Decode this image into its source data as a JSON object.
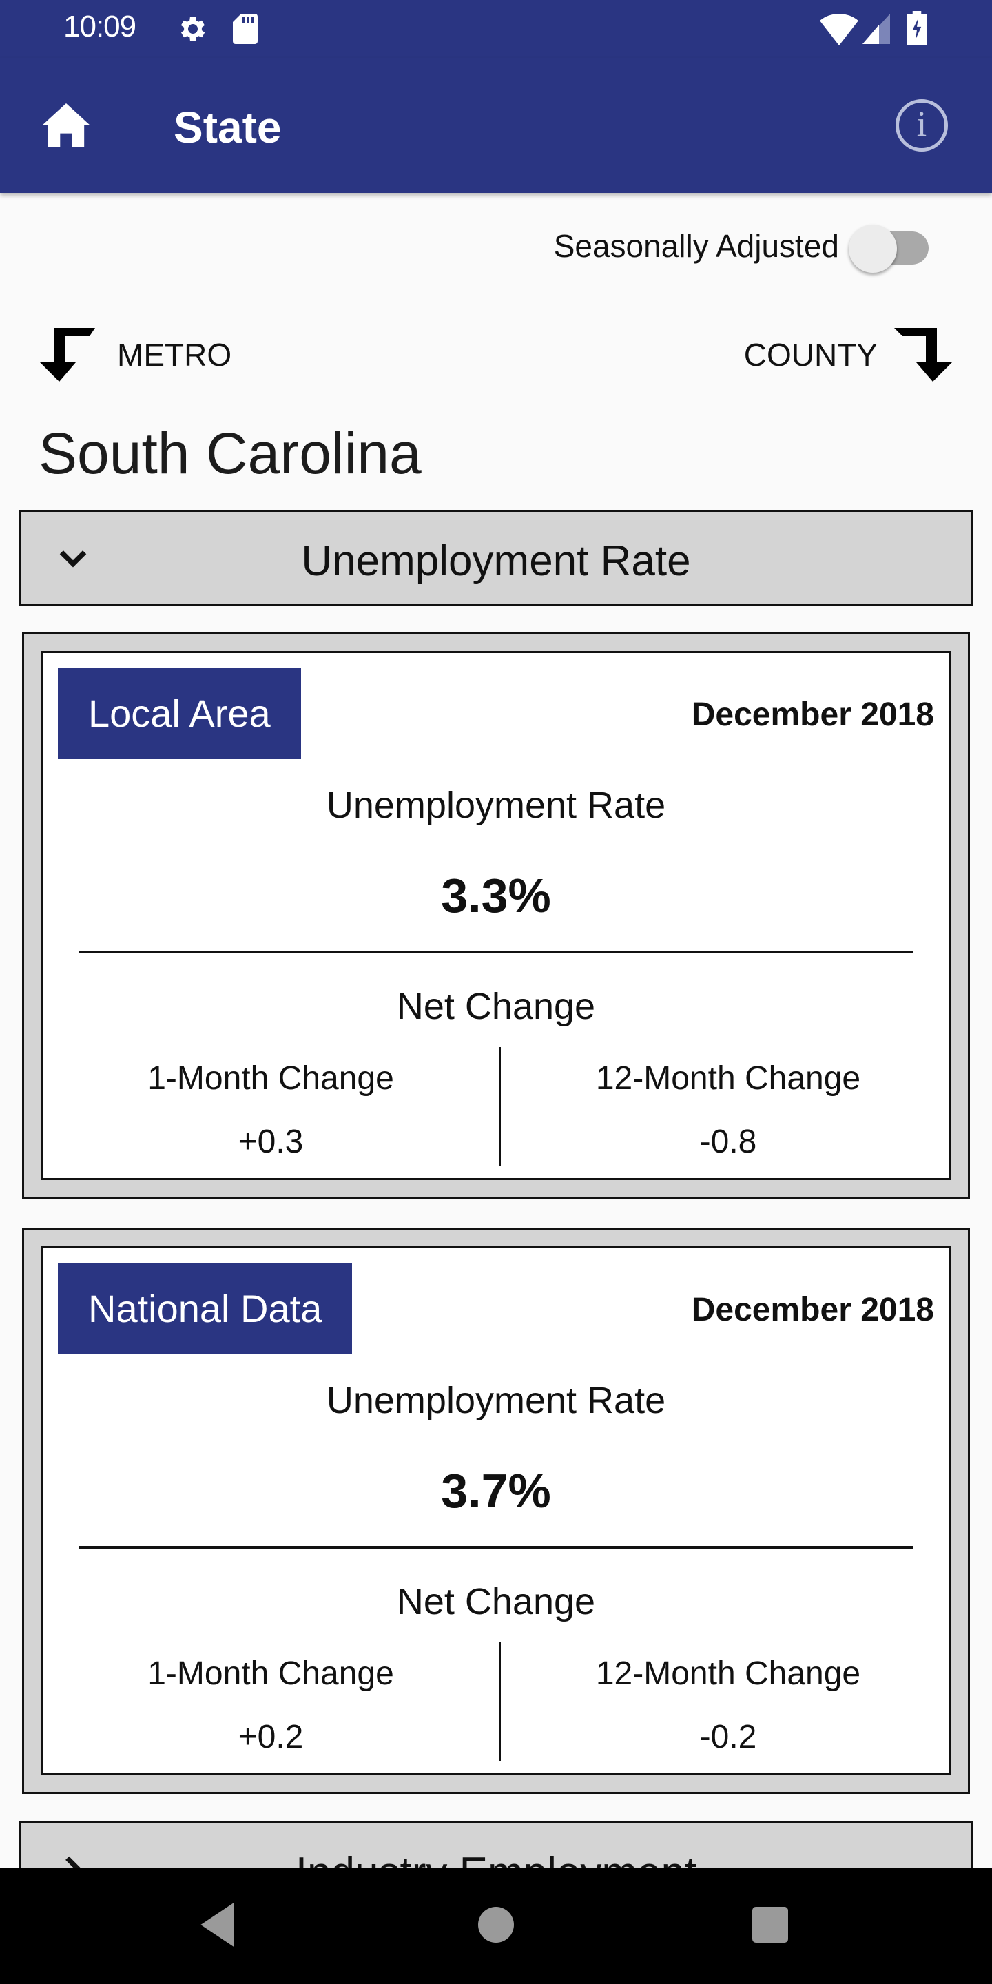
{
  "status_bar": {
    "time": "10:09",
    "icons": [
      "gear-icon",
      "sd-card-icon",
      "wifi-icon",
      "cell-signal-icon",
      "battery-charging-icon"
    ]
  },
  "app_bar": {
    "title": "State",
    "home_icon": "home-icon",
    "info_icon": "info-icon",
    "info_glyph": "i"
  },
  "controls": {
    "seasonally_adjusted_label": "Seasonally Adjusted",
    "seasonally_adjusted_on": false
  },
  "navigation": {
    "metro_label": "METRO",
    "county_label": "COUNTY"
  },
  "location": {
    "name": "South Carolina"
  },
  "sections": [
    {
      "title": "Unemployment Rate",
      "expanded": true,
      "cards": [
        {
          "badge": "Local Area",
          "date": "December 2018",
          "metric_label": "Unemployment Rate",
          "metric_value": "3.3%",
          "net_change_label": "Net Change",
          "one_month_label": "1-Month Change",
          "one_month_value": "+0.3",
          "twelve_month_label": "12-Month Change",
          "twelve_month_value": "-0.8"
        },
        {
          "badge": "National Data",
          "date": "December 2018",
          "metric_label": "Unemployment Rate",
          "metric_value": "3.7%",
          "net_change_label": "Net Change",
          "one_month_label": "1-Month Change",
          "one_month_value": "+0.2",
          "twelve_month_label": "12-Month Change",
          "twelve_month_value": "-0.2"
        }
      ]
    },
    {
      "title": "Industry Employment",
      "expanded": false
    }
  ],
  "system_nav": {
    "buttons": [
      "back",
      "home",
      "recents"
    ]
  },
  "colors": {
    "primary": "#2a3582",
    "section_bg": "#d4d4d4",
    "page_bg": "#fafafa"
  }
}
